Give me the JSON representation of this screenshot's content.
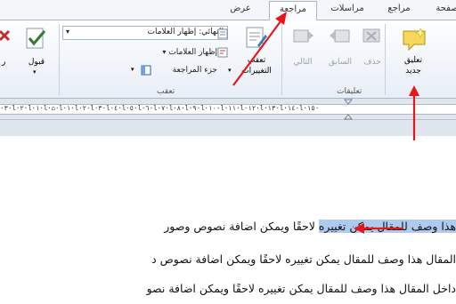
{
  "tabs": [
    "عرض",
    "مراجعة",
    "مراسلات",
    "مراجع",
    "صفحة"
  ],
  "active_tab": "مراجعة",
  "comments_group": {
    "label": "تعليقات",
    "new_comment": [
      "تعليق",
      "جديد"
    ],
    "delete": "حذف",
    "previous": "السابق",
    "next": "التالي"
  },
  "tracking_group": {
    "label": "تعقب",
    "track_changes": [
      "تعقب",
      "التغييرات"
    ],
    "display_for_review": "النهائي: إظهار العلامات",
    "show_markup": "إظهار العلامات",
    "reviewing_pane": "جزء المراجعة"
  },
  "changes_group": {
    "accept": "قبول",
    "reject_partial": "ر"
  },
  "ruler_text": "·٣·l·٢·l·١·l·⌂·l·١·l·٢·l·٣·l·٤·l·٥·l·٦·l·٧·l·٨·l·٩·l·١٠·l·١١·l·١٢·l·١٣·l·١٤·l·١٥·",
  "document": {
    "line1_highlight": "هذا وصف للمقال يمكن تغييره",
    "line1_rest": "لاحقًا ويمكن اضافة نصوص وصور",
    "line2": "المقال هذا وصف للمقال يمكن تغييره لاحقًا ويمكن اضافة نصوص د",
    "line3": "داخل المقال هذا وصف للمقال يمكن تغييره لاحقًا ويمكن اضافة نصو"
  },
  "colors": {
    "annotation_red": "#e8151b",
    "highlight": "#aecbef",
    "ribbon_border": "#a9b6c8"
  }
}
